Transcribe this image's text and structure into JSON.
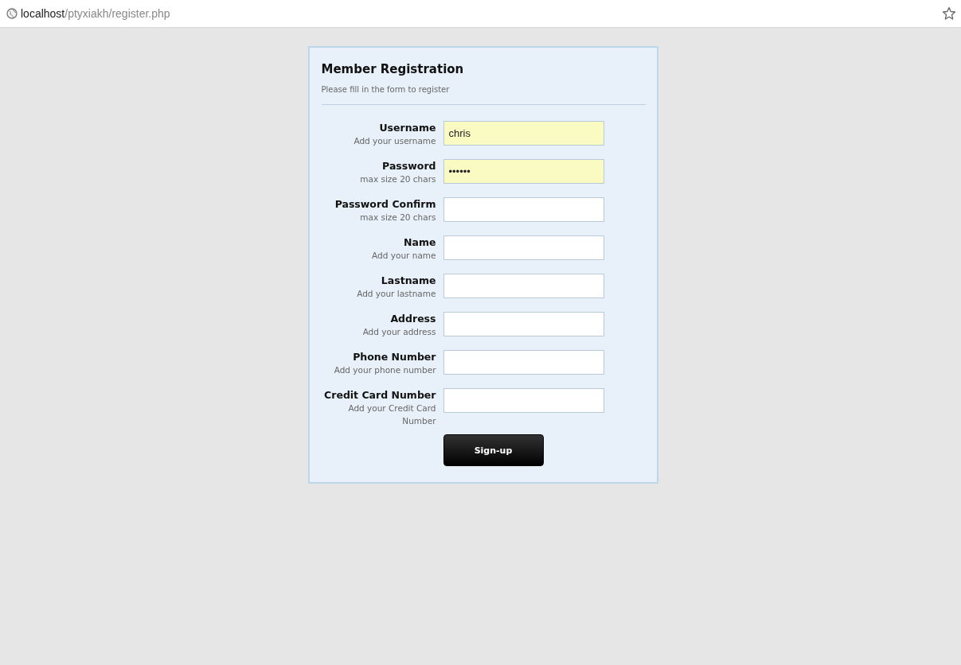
{
  "address_bar": {
    "host": "localhost",
    "path": "/ptyxiakh/register.php"
  },
  "form": {
    "title": "Member Registration",
    "subtitle": "Please fill in the form to register",
    "fields": [
      {
        "label": "Username",
        "hint": "Add your username",
        "value": "chris",
        "autofilled": true
      },
      {
        "label": "Password",
        "hint": "max size 20 chars",
        "value": "••••••",
        "autofilled": true
      },
      {
        "label": "Password Confirm",
        "hint": "max size 20 chars",
        "autofilled": false
      },
      {
        "label": "Name",
        "hint": "Add your name",
        "autofilled": false
      },
      {
        "label": "Lastname",
        "hint": "Add your lastname",
        "autofilled": false
      },
      {
        "label": "Address",
        "hint": "Add your address",
        "autofilled": false
      },
      {
        "label": "Phone Number",
        "hint": "Add your phone number",
        "autofilled": false
      },
      {
        "label": "Credit Card Number",
        "hint": "Add your Credit Card Number",
        "autofilled": false
      }
    ],
    "submit": "Sign-up"
  }
}
